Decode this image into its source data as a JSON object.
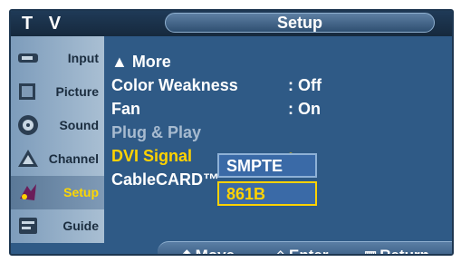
{
  "header": {
    "device_label": "T V",
    "title": "Setup"
  },
  "sidebar": {
    "items": [
      {
        "label": "Input",
        "icon": "input-icon",
        "active": false
      },
      {
        "label": "Picture",
        "icon": "picture-icon",
        "active": false
      },
      {
        "label": "Sound",
        "icon": "sound-icon",
        "active": false
      },
      {
        "label": "Channel",
        "icon": "channel-icon",
        "active": false
      },
      {
        "label": "Setup",
        "icon": "setup-icon",
        "active": true
      },
      {
        "label": "Guide",
        "icon": "guide-icon",
        "active": false
      }
    ]
  },
  "menu": {
    "more": "▲ More",
    "rows": [
      {
        "label": "Color Weakness",
        "value": ": Off"
      },
      {
        "label": "Fan",
        "value": ": On"
      },
      {
        "label": "Plug & Play",
        "value": ""
      },
      {
        "label": "DVI Signal",
        "value": ":"
      },
      {
        "label": "CableCARD™",
        "value": ""
      }
    ]
  },
  "popup": {
    "options": [
      "SMPTE",
      "861B"
    ],
    "selected": "861B"
  },
  "footer": {
    "move": "Move",
    "enter": "Enter",
    "return": "Return"
  },
  "colors": {
    "panel": "#2f5a86",
    "highlight": "#ffd200",
    "dim_text": "#a7bbd0"
  }
}
